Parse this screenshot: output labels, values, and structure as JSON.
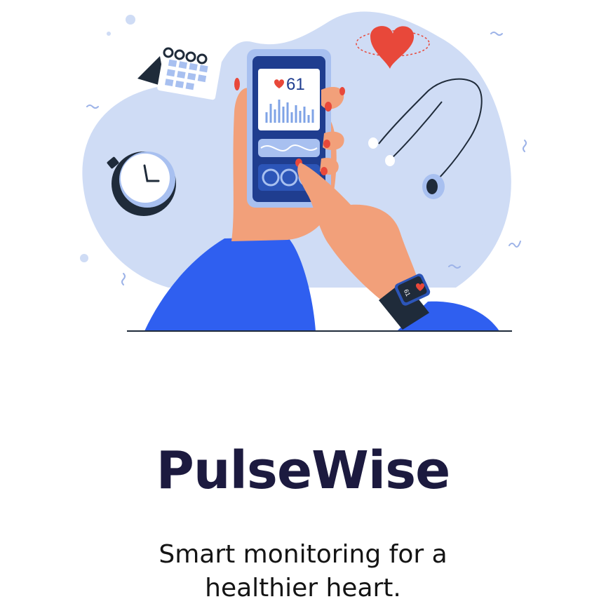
{
  "app": {
    "title": "PulseWise",
    "tagline": "Smart monitoring for a healthier heart."
  },
  "illustration": {
    "phone_heart_rate": "61",
    "watch_heart_rate": "61"
  },
  "colors": {
    "title": "#1c1a3f",
    "tagline": "#141414",
    "blob": "#cfdcf5",
    "phone_frame": "#1f3d8f",
    "sleeve": "#2f5ff0",
    "skin": "#f2a07a",
    "heart": "#e8483a"
  },
  "icons": [
    "calendar-icon",
    "stopwatch-icon",
    "heart-icon",
    "stethoscope-icon",
    "smartphone-icon",
    "smartwatch-icon"
  ]
}
